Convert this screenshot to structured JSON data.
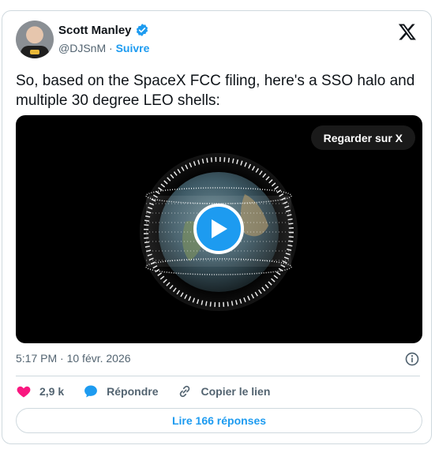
{
  "author": {
    "name": "Scott Manley",
    "handle": "@DJSnM",
    "separator": "·",
    "follow_label": "Suivre"
  },
  "tweet": {
    "text": "So, based on the SpaceX FCC filing, here's a SSO halo and multiple 30 degree LEO shells:"
  },
  "media": {
    "watch_label": "Regarder sur X"
  },
  "meta": {
    "time": "5:17 PM",
    "separator": "·",
    "date": "10 févr. 2026"
  },
  "actions": {
    "likes": "2,9 k",
    "reply_label": "Répondre",
    "copy_label": "Copier le lien"
  },
  "footer": {
    "read_replies_label": "Lire 166 réponses"
  },
  "colors": {
    "accent": "#1d9bf0",
    "like": "#f91880",
    "muted": "#536471",
    "border": "#cfd9de"
  },
  "icons": [
    "verified-badge-icon",
    "x-logo-icon",
    "play-icon",
    "info-icon",
    "heart-icon",
    "reply-bubble-icon",
    "link-icon"
  ]
}
